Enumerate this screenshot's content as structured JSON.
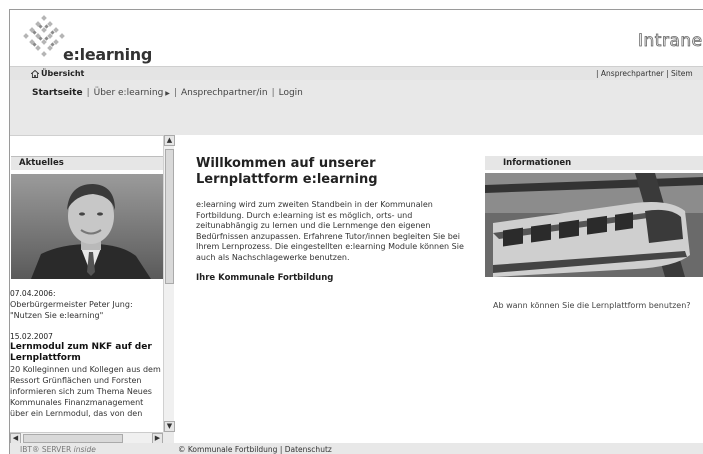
{
  "header": {
    "logo_text": "e:learning",
    "intranet_title": "Intrane"
  },
  "navbar1": {
    "home_label": "Übersicht",
    "util_links": "| Ansprechpartner | Sitem"
  },
  "mainnav": {
    "items": [
      {
        "label": "Startseite",
        "active": true
      },
      {
        "label": "Über e:learning",
        "has_submenu": true
      },
      {
        "label": "Ansprechpartner/in"
      },
      {
        "label": "Login"
      }
    ]
  },
  "left": {
    "heading": "Aktuelles",
    "news": [
      {
        "date": "07.04.2006:",
        "text": "Oberbürgermeister Peter Jung: \"Nutzen Sie e:learning\""
      },
      {
        "date": "15.02.2007",
        "title": "Lernmodul zum NKF auf der Lernplattform",
        "text": "20 Kolleginnen und Kollegen aus dem Ressort Grünflächen und Forsten informieren sich zum Thema Neues Kommunales Finanzmanagement über ein Lernmodul, das von den"
      }
    ]
  },
  "main": {
    "title": "Willkommen auf unserer Lernplattform e:learning",
    "body": "e:learning wird zum zweiten Standbein in der Kommunalen Fortbildung. Durch e:learning ist es möglich, orts- und zeitunabhängig zu lernen und die Lernmenge den eigenen Bedürfnissen anzupassen. Erfahrene Tutor/innen begleiten Sie bei Ihrem Lernprozess. Die eingestellten e:learning Module können Sie auch als Nachschlagewerke benutzen.",
    "subheading": "Ihre Kommunale Fortbildung"
  },
  "right": {
    "heading": "Informationen",
    "text": "Ab wann können Sie die Lernplattform benutzen?"
  },
  "footer": {
    "left_prefix": "IBT® SERVER",
    "left_suffix": "inside",
    "right": "© Kommunale Fortbildung  |  Datenschutz"
  },
  "colors": {
    "nav_bg": "#e8e8e8",
    "header_bar": "#e4e4e4",
    "section_head": "#e6e6e6"
  }
}
